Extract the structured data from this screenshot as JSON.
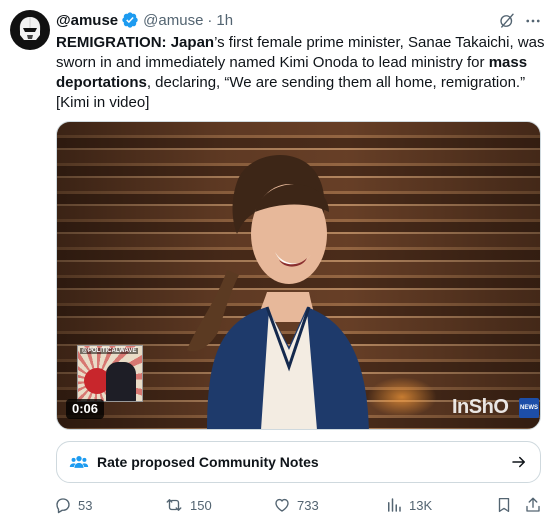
{
  "post": {
    "display_name": "@amuse",
    "handle": "@amuse",
    "separator": "·",
    "time": "1h",
    "text": {
      "p1_bold": "REMIGRATION: ",
      "p2_bold": "Japan",
      "p3": "’s first female prime minister, Sanae Takaichi, was sworn in and immediately named Kimi Onoda to lead ministry for ",
      "p4_bold": "mass deportations",
      "p5": ", declaring, “We are sending them all home, remigration.” [Kimi in video]"
    }
  },
  "media": {
    "duration": "0:06",
    "watermark": "InShO",
    "news_badge": "NEWS",
    "inset_caption": "@POLITICALWAVE"
  },
  "community_notes": {
    "label": "Rate proposed Community Notes"
  },
  "actions": {
    "replies": "53",
    "reposts": "150",
    "likes": "733",
    "views": "13K"
  },
  "colors": {
    "text": "#0f1419",
    "secondary": "#536471",
    "verified": "#1d9bf0",
    "notes_icon": "#1d9bf0",
    "border": "#cfd9de"
  },
  "icons": {
    "verified": "verified-badge-icon",
    "grok": "grok-icon",
    "more": "more-icon",
    "notes": "community-notes-icon",
    "arrow": "arrow-right-icon",
    "reply": "reply-icon",
    "repost": "repost-icon",
    "like": "heart-icon",
    "views": "views-icon",
    "bookmark": "bookmark-icon",
    "share": "share-icon"
  }
}
